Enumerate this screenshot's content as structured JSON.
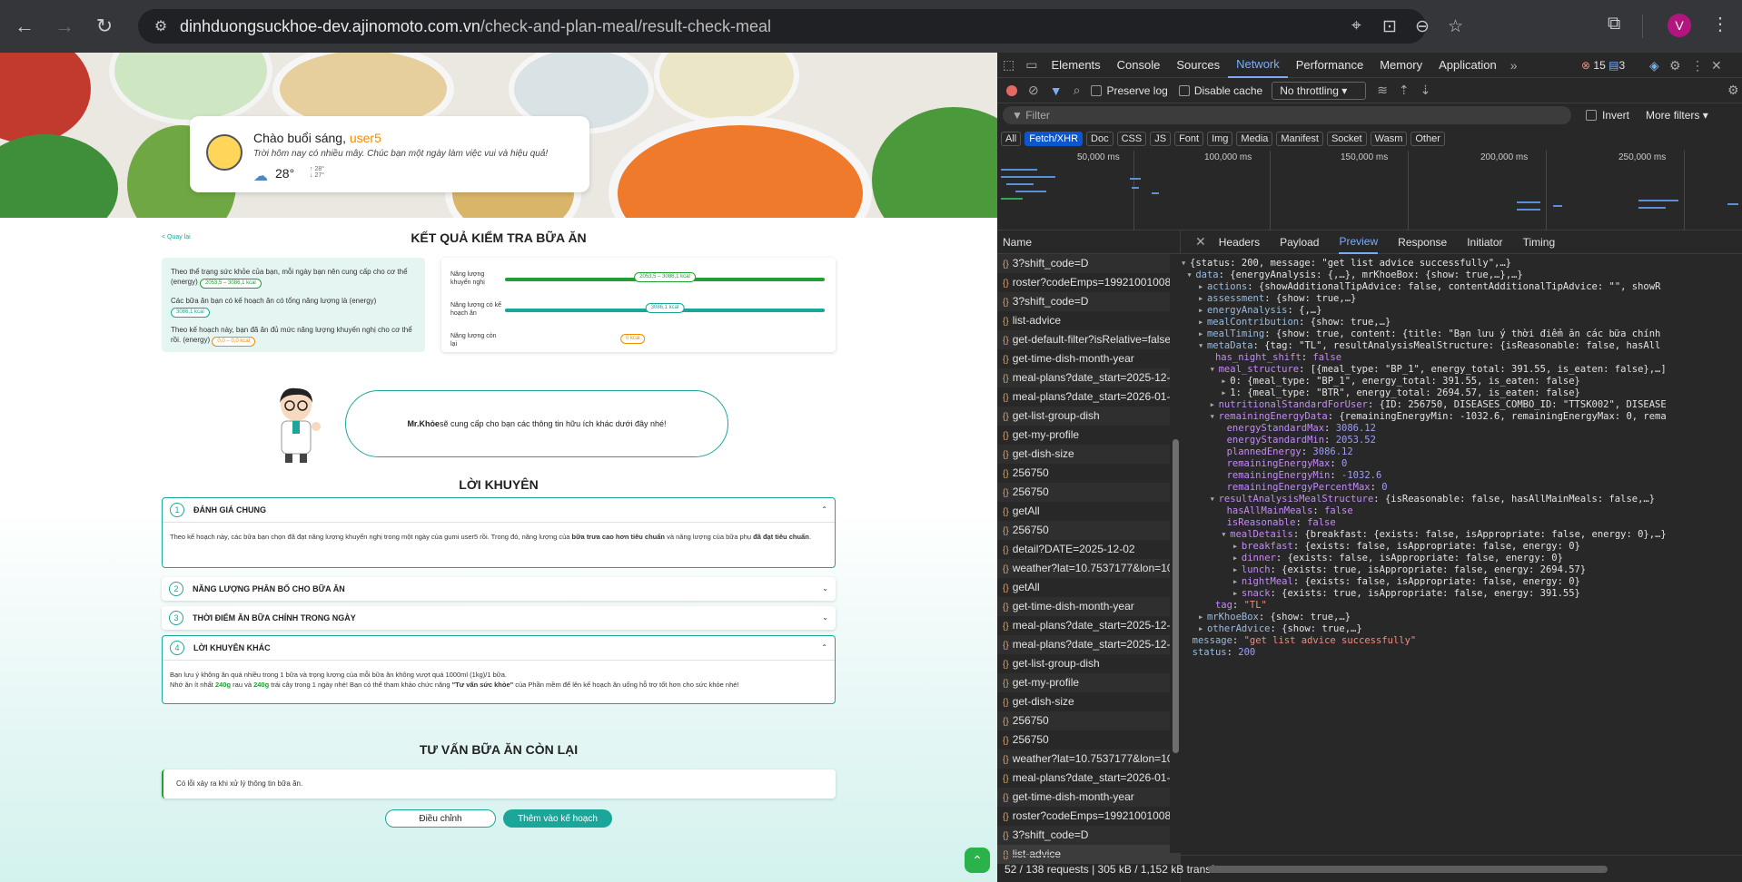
{
  "browser": {
    "url_host": "dinhduongsuckhoe-dev.ajinomoto.com.vn",
    "url_path": "/check-and-plan-meal/result-check-meal",
    "avatar_letter": "V"
  },
  "greeting": {
    "hello": "Chào buổi sáng, ",
    "user": "user5",
    "message": "Trời hôm nay có nhiều mây. Chúc bạn một ngày làm việc vui và hiệu quả!",
    "temp": "28°",
    "temp_max": "↑ 28°",
    "temp_min": "↓ 27°"
  },
  "page": {
    "back": "< Quay lại",
    "title": "KẾT QUẢ KIỂM TRA BỮA ĂN",
    "left": {
      "p1": "Theo thể trạng sức khỏe của bạn, mỗi ngày bạn nên cung cấp cho cơ thể (energy)",
      "p1_pill": "2053,5 – 3086,1 kcal",
      "p2": "Các bữa ăn bạn có kế hoạch ăn có tổng năng lượng là (energy)",
      "p2_pill": "3086,1 kcal",
      "p3": "Theo kế hoạch này, bạn đã ăn đủ mức năng lượng khuyến nghị cho cơ thể rồi. (energy)",
      "p3_pill": "0,0 – 0,0 kcal"
    },
    "bars": [
      {
        "label": "Năng lượng khuyến nghị",
        "tag": "2053,5 – 3086,1 kcal",
        "fill": 1.0,
        "color": "#22a033"
      },
      {
        "label": "Năng lượng có kế hoạch ăn",
        "tag": "3086,1 kcal",
        "fill": 1.0,
        "color": "#1aa79a"
      },
      {
        "label": "Năng lượng còn lại",
        "tag": "0 kcal",
        "fill": 0,
        "color": "#f28c00"
      }
    ],
    "mrkhoe_name": "Mr.Khỏe",
    "mrkhoe_text": " sẽ cung cấp cho bạn các thông tin hữu ích khác dưới đây nhé!",
    "advice_title": "LỜI KHUYÊN",
    "acc1": {
      "num": "1",
      "title": "ĐÁNH GIÁ CHUNG",
      "b1": "Theo kế hoạch này, các bữa bạn chọn đã đạt năng lượng khuyến nghị trong một ngày của gumi user5 rồi. Trong đó, năng lượng của ",
      "b2": "bữa trưa cao hơn tiêu chuẩn",
      "b3": " và năng lượng của bữa phụ ",
      "b4": "đã đạt tiêu chuẩn",
      "b5": "."
    },
    "acc2": {
      "num": "2",
      "title": "NĂNG LƯỢNG PHÂN BỐ CHO BỮA ĂN"
    },
    "acc3": {
      "num": "3",
      "title": "THỜI ĐIỂM ĂN BỮA CHÍNH TRONG NGÀY"
    },
    "acc4": {
      "num": "4",
      "title": "LỜI KHUYÊN KHÁC",
      "l1": "Bạn lưu ý không ăn quá nhiều trong 1 bữa và trọng lượng của mỗi bữa ăn không vượt quá 1000ml (1kg)/1 bữa.",
      "l2a": "Nhớ ăn ít nhất ",
      "l2b": "240g",
      "l2c": " rau và ",
      "l2d": "240g",
      "l2e": " trái cây trong 1 ngày nhé! Bạn có thể tham khảo chức năng ",
      "l2f": "\"Tư vấn sức khỏe\"",
      "l2g": " của Phần mềm để lên kế hoạch ăn uống hỗ trợ tốt hơn cho sức khỏe nhé!"
    },
    "remain_title": "TƯ VẤN BỮA ĂN CÒN LẠI",
    "error": "Có lỗi xảy ra khi xử lý thông tin bữa ăn.",
    "btn_adjust": "Điều chỉnh",
    "btn_add": "Thêm vào kế hoạch"
  },
  "devtools": {
    "tabs": [
      "Elements",
      "Console",
      "Sources",
      "Network",
      "Performance",
      "Memory",
      "Application"
    ],
    "active_tab": "Network",
    "errors": "15",
    "messages": "3",
    "preserve_log": "Preserve log",
    "disable_cache": "Disable cache",
    "throttling": "No throttling",
    "filter_placeholder": "Filter",
    "invert": "Invert",
    "more_filters": "More filters ▾",
    "types": [
      "All",
      "Fetch/XHR",
      "Doc",
      "CSS",
      "JS",
      "Font",
      "Img",
      "Media",
      "Manifest",
      "Socket",
      "Wasm",
      "Other"
    ],
    "active_type": "Fetch/XHR",
    "ticks": [
      "50,000 ms",
      "100,000 ms",
      "150,000 ms",
      "200,000 ms",
      "250,000 ms"
    ],
    "name_header": "Name",
    "requests": [
      "3?shift_code=D",
      "roster?codeEmps=19921001008&dat...",
      "3?shift_code=D",
      "list-advice",
      "get-default-filter?isRelative=false",
      "get-time-dish-month-year",
      "meal-plans?date_start=2025-12-01&...",
      "meal-plans?date_start=2026-01-01&...",
      "get-list-group-dish",
      "get-my-profile",
      "get-dish-size",
      "256750",
      "256750",
      "getAll",
      "256750",
      "detail?DATE=2025-12-02",
      "weather?lat=10.7537177&lon=106.6...",
      "getAll",
      "get-time-dish-month-year",
      "meal-plans?date_start=2025-12-01&...",
      "meal-plans?date_start=2025-12-01&...",
      "get-list-group-dish",
      "get-my-profile",
      "get-dish-size",
      "256750",
      "256750",
      "weather?lat=10.7537177&lon=106.6...",
      "meal-plans?date_start=2026-01-01&...",
      "get-time-dish-month-year",
      "roster?codeEmps=19921001008&dat...",
      "3?shift_code=D",
      "list-advice"
    ],
    "footer": "52 / 138 requests  |  305 kB / 1,152 kB transfe",
    "detail_tabs": [
      "Headers",
      "Payload",
      "Preview",
      "Response",
      "Initiator",
      "Timing"
    ],
    "active_detail_tab": "Preview"
  }
}
